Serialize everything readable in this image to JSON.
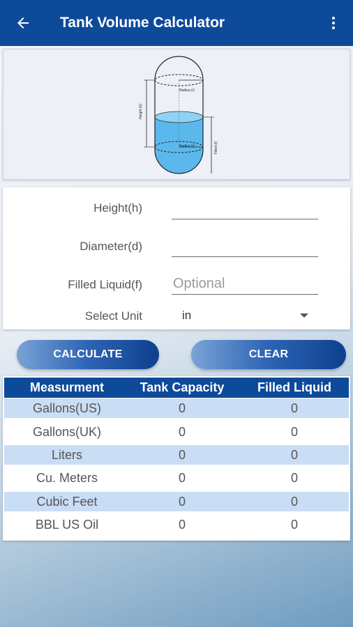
{
  "app_bar": {
    "title": "Tank Volume Calculator",
    "back_icon": "arrow-left-icon",
    "menu_icon": "more-vert-icon",
    "color": "#0e4a9a"
  },
  "diagram": {
    "radius_label": "Radius (r)",
    "height_label": "Height (h)",
    "filled_label": "Filled (f)",
    "liquid_color": "#5bb8ec"
  },
  "form": {
    "height_label": "Height(h)",
    "height_value": "",
    "diameter_label": "Diameter(d)",
    "diameter_value": "",
    "filled_label": "Filled Liquid(f)",
    "filled_placeholder": "Optional",
    "unit_label": "Select Unit",
    "unit_value": "in"
  },
  "buttons": {
    "calculate": "CALCULATE",
    "clear": "CLEAR"
  },
  "results": {
    "headers": [
      "Measurment",
      "Tank Capacity",
      "Filled Liquid"
    ],
    "rows": [
      {
        "name": "Gallons(US)",
        "capacity": "0",
        "filled": "0"
      },
      {
        "name": "Gallons(UK)",
        "capacity": "0",
        "filled": "0"
      },
      {
        "name": "Liters",
        "capacity": "0",
        "filled": "0"
      },
      {
        "name": "Cu. Meters",
        "capacity": "0",
        "filled": "0"
      },
      {
        "name": "Cubic Feet",
        "capacity": "0",
        "filled": "0"
      },
      {
        "name": "BBL US Oil",
        "capacity": "0",
        "filled": "0"
      }
    ]
  }
}
